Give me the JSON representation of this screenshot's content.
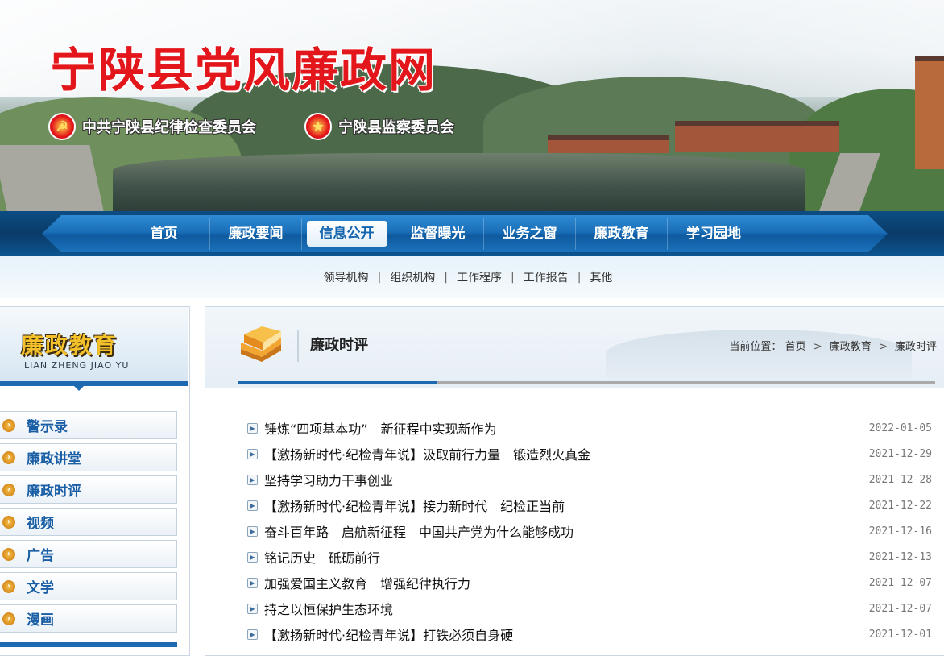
{
  "banner": {
    "site_title": "宁陕县党风廉政网",
    "org_left": "中共宁陕县纪律检查委员会",
    "org_right": "宁陕县监察委员会"
  },
  "nav": {
    "items": [
      {
        "label": "首页"
      },
      {
        "label": "廉政要闻"
      },
      {
        "label": "信息公开",
        "active": true
      },
      {
        "label": "监督曝光"
      },
      {
        "label": "业务之窗"
      },
      {
        "label": "廉政教育"
      },
      {
        "label": "学习园地"
      }
    ]
  },
  "subnav": {
    "items": [
      "领导机构",
      "组织机构",
      "工作程序",
      "工作报告",
      "其他"
    ],
    "separator": "|"
  },
  "sidebar": {
    "title_cn": "廉政教育",
    "title_en": "LIAN ZHENG JIAO YU",
    "items": [
      "警示录",
      "廉政讲堂",
      "廉政时评",
      "视频",
      "广告",
      "文学",
      "漫画"
    ]
  },
  "content": {
    "title": "廉政时评",
    "breadcrumb": {
      "prefix": "当前位置：",
      "items": [
        "首页",
        "廉政教育",
        "廉政时评"
      ],
      "arrow": ">"
    },
    "articles": [
      {
        "title": "锤炼“四项基本功”　新征程中实现新作为",
        "date": "2022-01-05"
      },
      {
        "title": "【激扬新时代·纪检青年说】汲取前行力量　锻造烈火真金",
        "date": "2021-12-29"
      },
      {
        "title": "坚持学习助力干事创业",
        "date": "2021-12-28"
      },
      {
        "title": "【激扬新时代·纪检青年说】接力新时代　纪检正当前",
        "date": "2021-12-22"
      },
      {
        "title": "奋斗百年路　启航新征程　中国共产党为什么能够成功",
        "date": "2021-12-16"
      },
      {
        "title": "铭记历史　砥砺前行",
        "date": "2021-12-13"
      },
      {
        "title": "加强爱国主义教育　增强纪律执行力",
        "date": "2021-12-07"
      },
      {
        "title": "持之以恒保护生态环境",
        "date": "2021-12-07"
      },
      {
        "title": "【激扬新时代·纪检青年说】打铁必须自身硬",
        "date": "2021-12-01"
      }
    ]
  },
  "colors": {
    "title_red": "#e3161b",
    "nav_blue": "#1a6fb8",
    "link_blue": "#1a5ea5",
    "accent_bar": "#1d6ab0"
  },
  "icons": {
    "party_emblem": "party-emblem-icon",
    "national_emblem": "national-emblem-icon",
    "section_book": "book-icon",
    "list_bullet": "play-bullet-icon",
    "side_bullet": "chevron-right-circle-icon"
  }
}
